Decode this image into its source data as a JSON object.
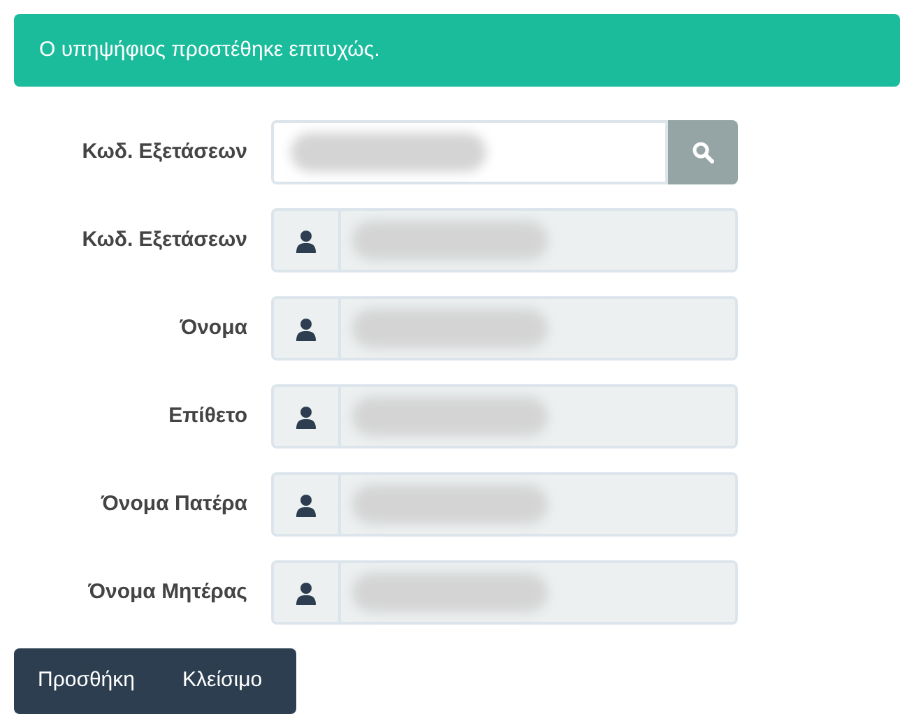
{
  "alert": {
    "message": "Ο υπηψήφιος προστέθηκε επιτυχώς."
  },
  "fields": [
    {
      "label": "Κωδ. Εξετάσεων",
      "kind": "search",
      "disabled": false,
      "redacted": true
    },
    {
      "label": "Κωδ. Εξετάσεων",
      "kind": "person",
      "disabled": true,
      "redacted": true
    },
    {
      "label": "Όνομα",
      "kind": "person",
      "disabled": true,
      "redacted": true
    },
    {
      "label": "Επίθετο",
      "kind": "person",
      "disabled": true,
      "redacted": true
    },
    {
      "label": "Όνομα Πατέρα",
      "kind": "person",
      "disabled": true,
      "redacted": true
    },
    {
      "label": "Όνομα Μητέρας",
      "kind": "person",
      "disabled": true,
      "redacted": true
    }
  ],
  "buttons": [
    "Προσθήκη",
    "Κλείσιμο"
  ]
}
